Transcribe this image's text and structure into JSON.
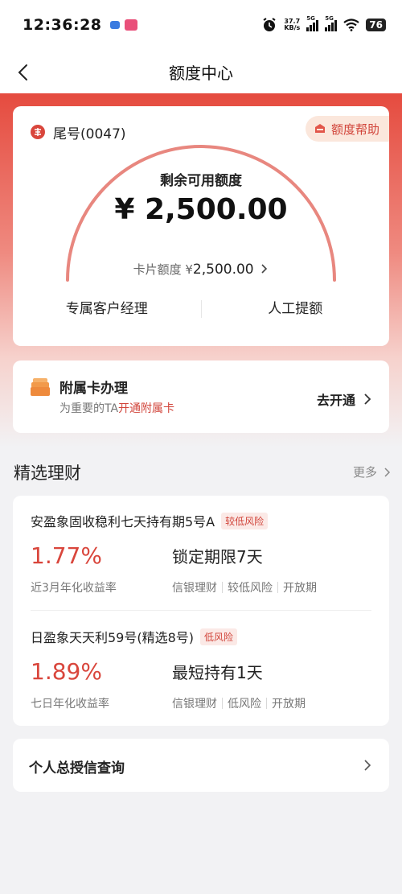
{
  "status_bar": {
    "time": "12:36:28",
    "net_speed_value": "37.7",
    "net_speed_unit": "KB/s",
    "signal1": "5G",
    "signal2": "5G",
    "battery": "76"
  },
  "nav": {
    "title": "额度中心"
  },
  "credit_card": {
    "tail_label": "尾号(0047)",
    "help_label": "额度帮助",
    "remaining_label": "剩余可用额度",
    "remaining_amount": "¥ 2,500.00",
    "card_limit_label": "卡片额度 ¥",
    "card_limit_value": "2,500.00",
    "action_left": "专属客户经理",
    "action_right": "人工提额"
  },
  "supplementary": {
    "title": "附属卡办理",
    "desc_prefix": "为重要的TA",
    "desc_highlight": "开通附属卡",
    "go_label": "去开通"
  },
  "finance": {
    "section_title": "精选理财",
    "more_label": "更多",
    "products": [
      {
        "name": "安盈象固收稳利七天持有期5号A",
        "risk": "较低风险",
        "rate": "1.77%",
        "rate_label": "近3月年化收益率",
        "term": "锁定期限7天",
        "tags": [
          "信银理财",
          "较低风险",
          "开放期"
        ]
      },
      {
        "name": "日盈象天天利59号(精选8号)",
        "risk": "低风险",
        "rate": "1.89%",
        "rate_label": "七日年化收益率",
        "term": "最短持有1天",
        "tags": [
          "信银理财",
          "低风险",
          "开放期"
        ]
      }
    ]
  },
  "credit_query": {
    "title": "个人总授信查询"
  },
  "colors": {
    "brand_red": "#d9463c",
    "gauge_arc": "#e8877f",
    "hero_top": "#e54b3f"
  }
}
